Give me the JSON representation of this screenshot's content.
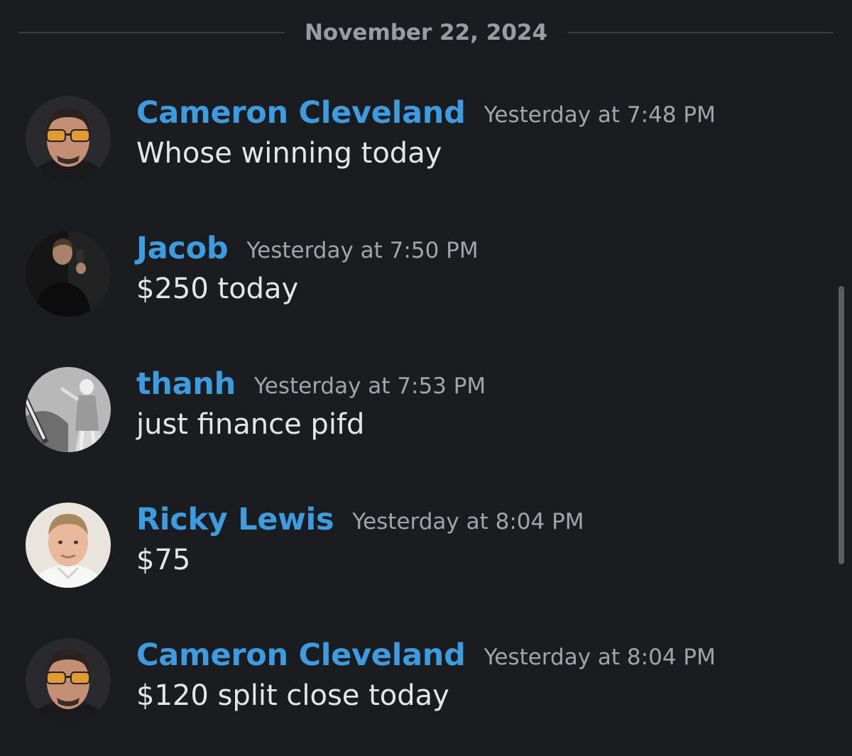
{
  "date_divider": "November 22, 2024",
  "messages": [
    {
      "username": "Cameron Cleveland",
      "timestamp": "Yesterday at 7:48 PM",
      "content": "Whose winning today"
    },
    {
      "username": "Jacob",
      "timestamp": "Yesterday at 7:50 PM",
      "content": "$250 today"
    },
    {
      "username": "thanh",
      "timestamp": "Yesterday at 7:53 PM",
      "content": "just finance pifd"
    },
    {
      "username": "Ricky Lewis",
      "timestamp": "Yesterday at 8:04 PM",
      "content": "$75"
    },
    {
      "username": "Cameron Cleveland",
      "timestamp": "Yesterday at 8:04 PM",
      "content": "$120 split close today"
    }
  ],
  "colors": {
    "background": "#1b1c20",
    "username": "#3d9be0",
    "timestamp": "#a2a4ab",
    "content": "#e4e5e8",
    "divider": "#3a3c42"
  }
}
